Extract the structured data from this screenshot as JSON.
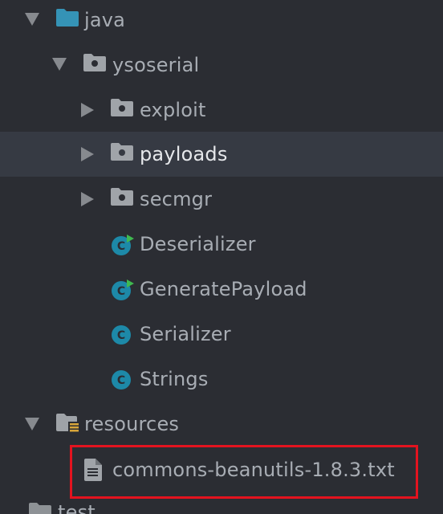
{
  "tree": {
    "items": [
      {
        "label": "java",
        "kind": "source-folder",
        "expanded": true
      },
      {
        "label": "ysoserial",
        "kind": "package",
        "expanded": true
      },
      {
        "label": "exploit",
        "kind": "package",
        "expanded": false
      },
      {
        "label": "payloads",
        "kind": "package",
        "expanded": false,
        "selected": true
      },
      {
        "label": "secmgr",
        "kind": "package",
        "expanded": false
      },
      {
        "label": "Deserializer",
        "kind": "class-runnable"
      },
      {
        "label": "GeneratePayload",
        "kind": "class-runnable"
      },
      {
        "label": "Serializer",
        "kind": "class"
      },
      {
        "label": "Strings",
        "kind": "class"
      },
      {
        "label": "resources",
        "kind": "resources-folder",
        "expanded": true
      },
      {
        "label": "commons-beanutils-1.8.3.txt",
        "kind": "text-file",
        "highlighted": true
      },
      {
        "label": "test",
        "kind": "folder",
        "expanded": false
      }
    ]
  },
  "colors": {
    "background": "#2b2d33",
    "selected_row": "#363a43",
    "text": "#a8adb4",
    "selected_text": "#e6e8eb",
    "source_folder": "#3593b6",
    "package_folder": "#a0a4a9",
    "class_icon": "#1d89a8",
    "run_badge": "#3fb950",
    "highlight_border": "#e3131f"
  }
}
